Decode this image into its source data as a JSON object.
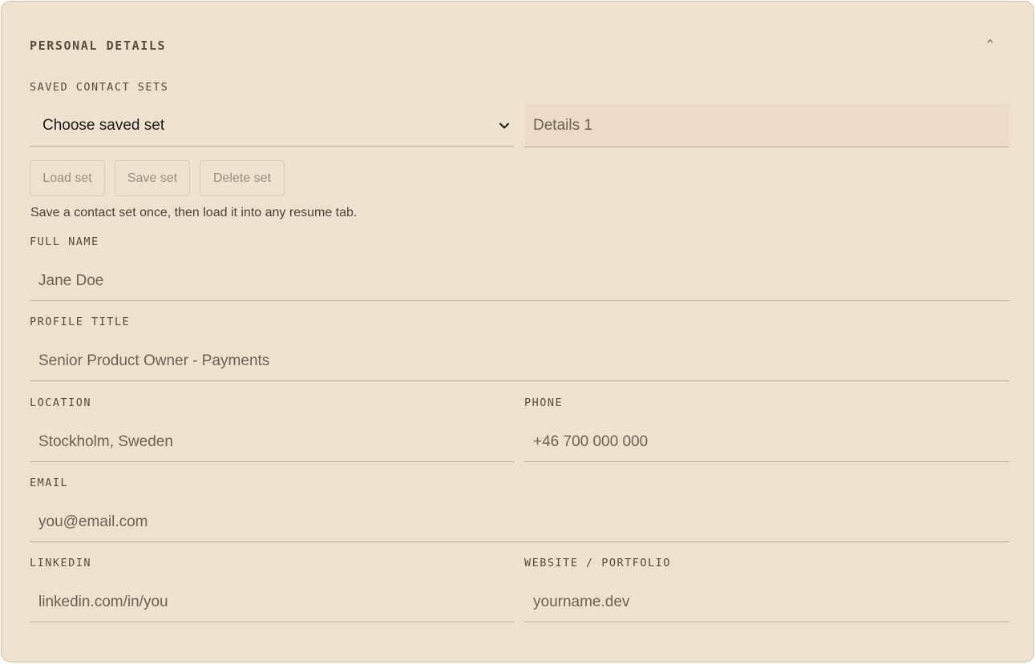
{
  "section": {
    "title": "PERSONAL DETAILS",
    "collapse_symbol": "^"
  },
  "saved_sets": {
    "label": "SAVED CONTACT SETS",
    "select_value": "Choose saved set",
    "set_name_value": "Details 1",
    "load_label": "Load set",
    "save_label": "Save set",
    "delete_label": "Delete set",
    "helper_text": "Save a contact set once, then load it into any resume tab."
  },
  "fields": {
    "full_name": {
      "label": "FULL NAME",
      "value": "Jane Doe"
    },
    "profile_title": {
      "label": "PROFILE TITLE",
      "value": "Senior Product Owner - Payments"
    },
    "location": {
      "label": "LOCATION",
      "value": "Stockholm, Sweden"
    },
    "phone": {
      "label": "PHONE",
      "value": "+46 700 000 000"
    },
    "email": {
      "label": "EMAIL",
      "value": "you@email.com"
    },
    "linkedin": {
      "label": "LINKEDIN",
      "value": "linkedin.com/in/you"
    },
    "website": {
      "label": "WEBSITE / PORTFOLIO",
      "value": "yourname.dev"
    }
  },
  "colors": {
    "panel_background": "#ede1cf",
    "input_fill": "#eadcc6",
    "text_primary": "#4a3f33",
    "button_text": "#9b8f80"
  },
  "icons": {
    "select_arrow": "chevron-down-icon",
    "collapse": "chevron-up-icon"
  }
}
